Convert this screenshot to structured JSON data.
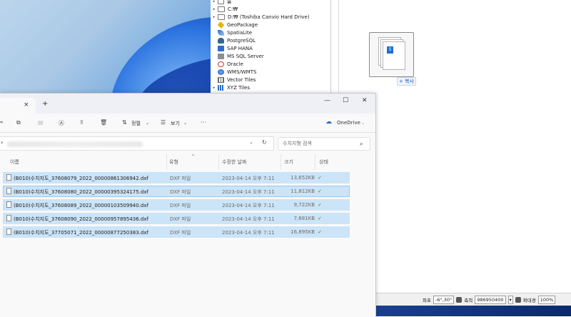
{
  "qgis_browser": {
    "items": [
      {
        "label": "홈",
        "icon": "home-icon",
        "arrow": "▸"
      },
      {
        "label": "C:₩",
        "icon": "drive-icon",
        "arrow": "▸"
      },
      {
        "label": "D:₩ (Toshiba Canvio Hard Drive)",
        "icon": "drive-icon",
        "arrow": "▸"
      },
      {
        "label": "GeoPackage",
        "icon": "geopackage-icon",
        "arrow": ""
      },
      {
        "label": "SpatiaLite",
        "icon": "spatialite-icon",
        "arrow": ""
      },
      {
        "label": "PostgreSQL",
        "icon": "postgresql-icon",
        "arrow": ""
      },
      {
        "label": "SAP HANA",
        "icon": "sap-hana-icon",
        "arrow": ""
      },
      {
        "label": "MS SQL Server",
        "icon": "mssql-icon",
        "arrow": ""
      },
      {
        "label": "Oracle",
        "icon": "oracle-icon",
        "arrow": ""
      },
      {
        "label": "WMS/WMTS",
        "icon": "wms-icon",
        "arrow": ""
      },
      {
        "label": "Vector Tiles",
        "icon": "vector-tiles-icon",
        "arrow": ""
      },
      {
        "label": "XYZ Tiles",
        "icon": "xyz-tiles-icon",
        "arrow": "▸"
      }
    ]
  },
  "drag": {
    "badge": "5",
    "hint": "+ 복사"
  },
  "statusbar": {
    "coord_label": "좌표",
    "coord_value": "-6°,30°",
    "scale_label": "축척",
    "scale_value": "986950400",
    "magnify_label": "확대경",
    "magnify_value": "100%"
  },
  "explorer": {
    "tab_close": "×",
    "new_tab": "+",
    "window_buttons": [
      "—",
      "☐",
      "✕"
    ],
    "toolbar": {
      "sort_label": "정렬",
      "view_label": "보기",
      "more": "···",
      "onedrive_label": "OneDrive"
    },
    "address": {
      "chevron": "›",
      "dropdown": "⌄",
      "refresh": "↻"
    },
    "search": {
      "placeholder": "수치지형 검색",
      "icon": "⌕"
    },
    "columns": [
      "이름",
      "유형",
      "수정한 날짜",
      "크기",
      "상태"
    ],
    "files": [
      {
        "name": "(B010)수치지도_37608079_2022_00000861306942.dxf",
        "type": "DXF 파일",
        "date": "2023-04-14 오후 7:11",
        "size": "13,652KB",
        "status": "✓"
      },
      {
        "name": "(B010)수치지도_37608080_2022_00000395324175.dxf",
        "type": "DXF 파일",
        "date": "2023-04-14 오후 7:11",
        "size": "11,812KB",
        "status": "✓"
      },
      {
        "name": "(B010)수치지도_37608089_2022_00000103509940.dxf",
        "type": "DXF 파일",
        "date": "2023-04-14 오후 7:11",
        "size": "9,722KB",
        "status": "✓"
      },
      {
        "name": "(B010)수치지도_37608090_2022_00000957895436.dxf",
        "type": "DXF 파일",
        "date": "2023-04-14 오후 7:11",
        "size": "7,681KB",
        "status": "✓"
      },
      {
        "name": "(B010)수치지도_37705071_2022_00000877250383.dxf",
        "type": "DXF 파일",
        "date": "2023-04-14 오후 7:11",
        "size": "16,895KB",
        "status": "✓"
      }
    ]
  },
  "colors": {
    "selection": "#cce4f7",
    "accent": "#1e6fd0",
    "synced": "#2e8b2e"
  }
}
